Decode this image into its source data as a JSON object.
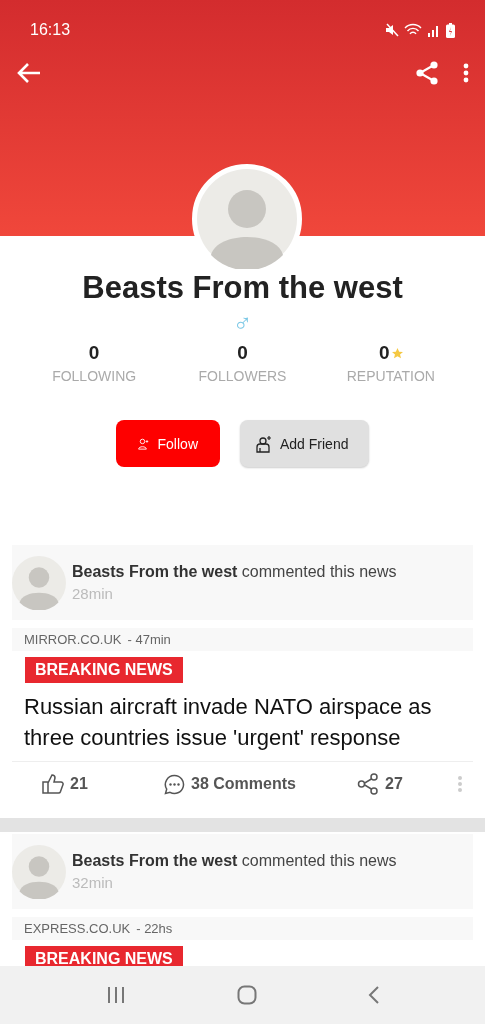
{
  "status_bar": {
    "time": "16:13"
  },
  "profile": {
    "name": "Beasts From the west",
    "gender": "♂",
    "stats": [
      {
        "value": "0",
        "label": "FOLLOWING",
        "kind": "count"
      },
      {
        "value": "0",
        "label": "FOLLOWERS",
        "kind": "count"
      },
      {
        "value": "0",
        "label": "REPUTATION",
        "kind": "rating"
      }
    ],
    "buttons": [
      {
        "label": "Follow",
        "kind": "primary"
      },
      {
        "label": "Add Friend",
        "kind": "secondary"
      }
    ]
  },
  "feed": [
    {
      "activity": "**Beasts From the west** commented this news",
      "time": "28min",
      "source": "MIRROR.CO.UK",
      "age": "- 47min",
      "badge": "BREAKING NEWS",
      "headline": "Russian aircraft invade NATO airspace as three countries issue 'urgent' response",
      "likes": "21",
      "comments": "38 Comments",
      "shares": "27"
    },
    {
      "activity": "**Beasts From the west** commented this news",
      "time": "32min",
      "source": "EXPRESS.CO.UK",
      "age": "- 22hs",
      "badge": "BREAKING NEWS"
    }
  ]
}
